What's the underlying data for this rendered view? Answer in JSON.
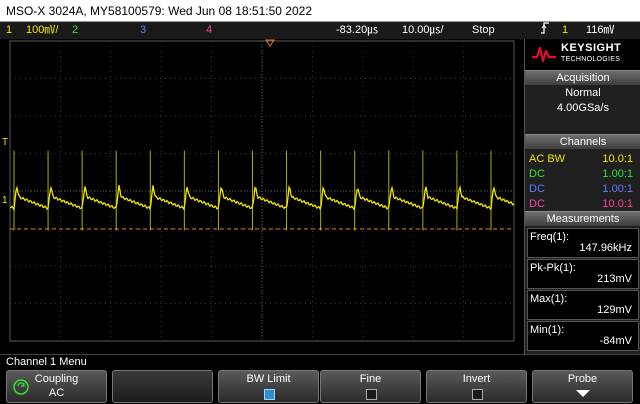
{
  "titlebar": {
    "text": "MSO-X 3024A, MY58100579: Wed Jun 08 18:51:50 2022"
  },
  "status": {
    "ch1_num": "1",
    "ch1_scale": "100㎷/",
    "ch2_num": "2",
    "ch3_num": "3",
    "ch4_num": "4",
    "delay": "-83.20㎲",
    "timebase": "10.00㎲/",
    "run_state": "Stop",
    "trigger_icon": "rising-edge-trigger-icon",
    "trigger_channel": "1",
    "trigger_level": "116㎷"
  },
  "markers": {
    "ground_label": "1",
    "trigger_label": "T"
  },
  "waveform": {
    "color": "#f2e600",
    "period_us": 6.76,
    "ripple_pkpk_mV": 213,
    "max_mV": 129,
    "min_mV": -84,
    "trigger_level_mV": 116
  },
  "brand": {
    "name": "KEYSIGHT",
    "sub": "TECHNOLOGIES"
  },
  "acquisition": {
    "heading": "Acquisition",
    "mode": "Normal",
    "rate": "4.00GSa/s"
  },
  "channels": {
    "heading": "Channels",
    "rows": [
      {
        "coupling": "AC BW",
        "probe": "10.0:1",
        "color": "#f2e600"
      },
      {
        "coupling": "DC",
        "probe": "1.00:1",
        "color": "#31e231"
      },
      {
        "coupling": "DC",
        "probe": "1.00:1",
        "color": "#5f7bff"
      },
      {
        "coupling": "DC",
        "probe": "10.0:1",
        "color": "#ff3f9c"
      }
    ]
  },
  "measurements": {
    "heading": "Measurements",
    "items": [
      {
        "label": "Freq(1):",
        "value": "147.96kHz"
      },
      {
        "label": "Pk-Pk(1):",
        "value": "213mV"
      },
      {
        "label": "Max(1):",
        "value": "129mV"
      },
      {
        "label": "Min(1):",
        "value": "-84mV"
      }
    ]
  },
  "menu": {
    "title": "Channel 1 Menu"
  },
  "softkeys": {
    "coupling_label": "Coupling",
    "coupling_value": "AC",
    "bw_limit_label": "BW Limit",
    "bw_limit_checked": true,
    "fine_label": "Fine",
    "fine_checked": false,
    "invert_label": "Invert",
    "invert_checked": false,
    "probe_label": "Probe"
  }
}
